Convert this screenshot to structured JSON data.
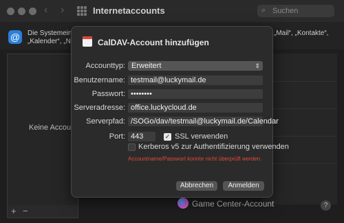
{
  "window": {
    "title": "Internetaccounts",
    "search_placeholder": "Suchen"
  },
  "info": {
    "line1_left": "Die Systemeins",
    "line2_left": "„Kalender“, „Na",
    "line1_right": "„Mail“, „Kontakte“,"
  },
  "accounts": {
    "empty_label": "Keine Accou",
    "add": "+",
    "remove": "−"
  },
  "game_center": {
    "label": "Game Center-Account"
  },
  "help": "?",
  "sheet": {
    "title": "CalDAV-Account hinzufügen",
    "account_type": {
      "label": "Accounttyp:",
      "value": "Erweitert"
    },
    "username": {
      "label": "Benutzername:",
      "value": "testmail@luckymail.de"
    },
    "password": {
      "label": "Passwort:",
      "value": "••••••••"
    },
    "server_address": {
      "label": "Serveradresse:",
      "value": "office.luckycloud.de"
    },
    "server_path": {
      "label": "Serverpfad:",
      "value": "/SOGo/dav/testmail@luckymail.de/Calendar"
    },
    "port": {
      "label": "Port:",
      "value": "443"
    },
    "ssl": {
      "label": "SSL verwenden",
      "checked": true
    },
    "kerberos": {
      "label": "Kerberos v5 zur Authentifizierung verwenden",
      "checked": false
    },
    "error": "Accountname/Passwort konnte nicht überprüft werden.",
    "cancel_button": "Abbrechen",
    "login_button": "Anmelden"
  }
}
